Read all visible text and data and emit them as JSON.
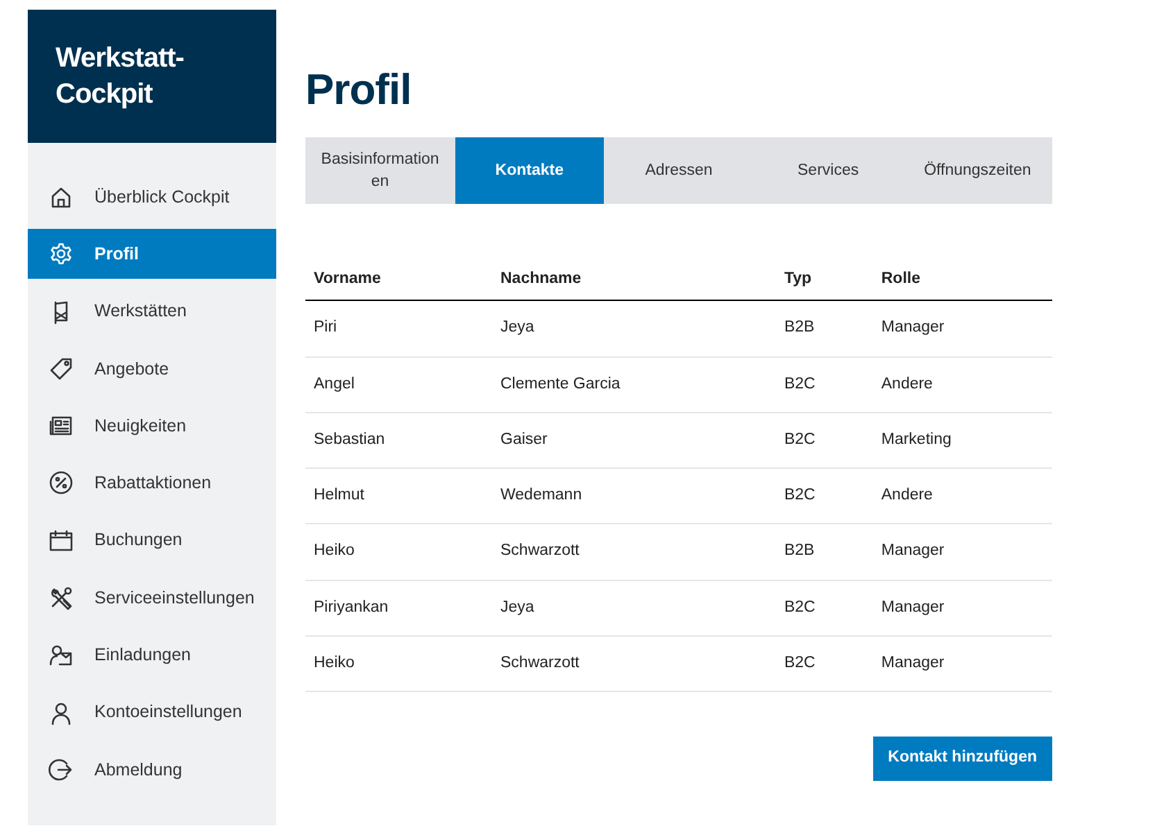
{
  "brand": {
    "title": "Werkstatt-Cockpit"
  },
  "sidebar": {
    "items": [
      {
        "label": "Überblick Cockpit",
        "selected": false
      },
      {
        "label": "Profil",
        "selected": true
      },
      {
        "label": "Werkstätten",
        "selected": false
      },
      {
        "label": "Angebote",
        "selected": false
      },
      {
        "label": "Neuigkeiten",
        "selected": false
      },
      {
        "label": "Rabattaktionen",
        "selected": false
      },
      {
        "label": "Buchungen",
        "selected": false
      },
      {
        "label": "Serviceeinstellungen",
        "selected": false
      },
      {
        "label": "Einladungen",
        "selected": false
      },
      {
        "label": "Kontoeinstellungen",
        "selected": false
      },
      {
        "label": "Abmeldung",
        "selected": false
      }
    ]
  },
  "page": {
    "title": "Profil"
  },
  "tabs": [
    {
      "label": "Basisinformationen",
      "selected": false
    },
    {
      "label": "Kontakte",
      "selected": true
    },
    {
      "label": "Adressen",
      "selected": false
    },
    {
      "label": "Services",
      "selected": false
    },
    {
      "label": "Öffnungszeiten",
      "selected": false
    }
  ],
  "table": {
    "columns": [
      "Vorname",
      "Nachname",
      "Typ",
      "Rolle"
    ],
    "rows": [
      [
        "Piri",
        "Jeya",
        "B2B",
        "Manager"
      ],
      [
        "Angel",
        "Clemente Garcia",
        "B2C",
        "Andere"
      ],
      [
        "Sebastian",
        "Gaiser",
        "B2C",
        "Marketing"
      ],
      [
        "Helmut",
        "Wedemann",
        "B2C",
        "Andere"
      ],
      [
        "Heiko",
        "Schwarzott",
        "B2B",
        "Manager"
      ],
      [
        "Piriyankan",
        "Jeya",
        "B2C",
        "Manager"
      ],
      [
        "Heiko",
        "Schwarzott",
        "B2C",
        "Manager"
      ]
    ]
  },
  "add_button": {
    "label": "Kontakt hinzufügen"
  }
}
